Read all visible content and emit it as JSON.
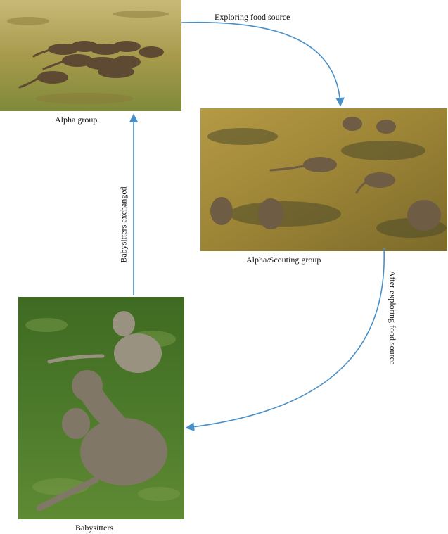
{
  "nodes": {
    "alpha_group": {
      "caption": "Alpha group",
      "icon": "mongoose-group-grazing-photo"
    },
    "alpha_scouting_group": {
      "caption": "Alpha/Scouting group",
      "icon": "mongoose-scouts-foraging-photo"
    },
    "babysitters": {
      "caption": "Babysitters",
      "icon": "mongoose-babysitters-with-pups-photo"
    }
  },
  "edges": {
    "exploring": {
      "label": "Exploring food source"
    },
    "after_exploring": {
      "label": "After exploring food source"
    },
    "exchanged": {
      "label": "Babysitters exchanged"
    }
  },
  "colors": {
    "arrow": "#4a90c8",
    "grass_light": "#a89a4c",
    "grass_green": "#4c7a2a",
    "mongoose": "#6b5a44"
  }
}
